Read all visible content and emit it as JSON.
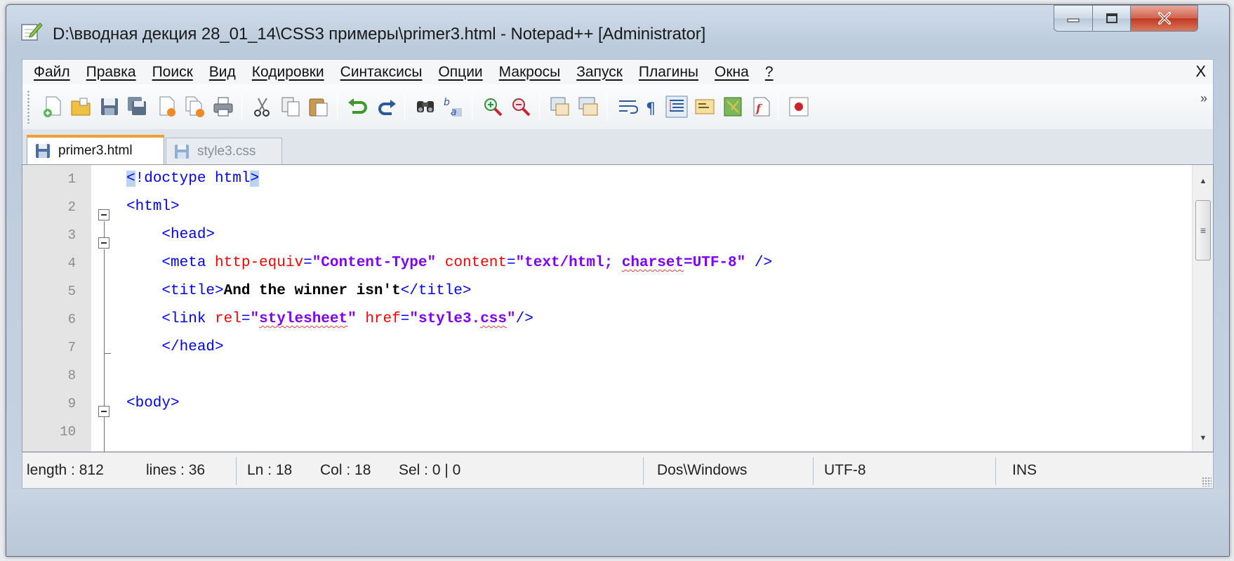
{
  "window": {
    "title": "D:\\вводная декция 28_01_14\\CSS3 примеры\\primer3.html - Notepad++ [Administrator]",
    "controls": {
      "minimize_icon": "minimize-icon",
      "maximize_icon": "maximize-icon",
      "close_icon": "close-icon"
    }
  },
  "menu": {
    "items": [
      "Файл",
      "Правка",
      "Поиск",
      "Вид",
      "Кодировки",
      "Синтаксисы",
      "Опции",
      "Макросы",
      "Запуск",
      "Плагины",
      "Окна",
      "?"
    ],
    "close": "X"
  },
  "toolbar": {
    "icons": [
      "new-file-icon",
      "open-file-icon",
      "save-icon",
      "save-all-icon",
      "close-icon",
      "close-all-icon",
      "print-icon",
      "cut-icon",
      "copy-icon",
      "paste-icon",
      "undo-icon",
      "redo-icon",
      "find-icon",
      "replace-icon",
      "zoom-in-icon",
      "zoom-out-icon",
      "sync-vertical-icon",
      "sync-horizontal-icon",
      "word-wrap-icon",
      "show-all-chars-icon",
      "indent-guide-icon",
      "user-language-icon",
      "doc-map-icon",
      "function-list-icon",
      "record-macro-icon"
    ],
    "more": "»"
  },
  "tabs": [
    {
      "label": "primer3.html",
      "active": true
    },
    {
      "label": "style3.css",
      "active": false
    }
  ],
  "editor": {
    "line_numbers": [
      "1",
      "2",
      "3",
      "4",
      "5",
      "6",
      "7",
      "8",
      "9",
      "10"
    ],
    "lines": {
      "l1": {
        "lt": "<",
        "sel": "!",
        "rest": "doctype html",
        "close": ">"
      },
      "l2": {
        "tag": "<html>"
      },
      "l3": {
        "indent": "    ",
        "tag": "<head>"
      },
      "l4": {
        "indent": "    ",
        "open": "<meta ",
        "a1": "http-equiv",
        "eq1": "=",
        "s1": "\"Content-Type\"",
        "sp": " ",
        "a2": "content",
        "eq2": "=",
        "s2a": "\"text/html; ",
        "s2b": "charset",
        "s2c": "=UTF-8\"",
        "end": " />"
      },
      "l5": {
        "indent": "    ",
        "open": "<title>",
        "text": "And the winner isn't",
        "close": "</title>"
      },
      "l6": {
        "indent": "    ",
        "open": "<link ",
        "a1": "rel",
        "eq1": "=",
        "s1a": "\"",
        "s1b": "stylesheet",
        "s1c": "\"",
        "sp": " ",
        "a2": "href",
        "eq2": "=",
        "s2a": "\"style3.",
        "s2b": "css",
        "s2c": "\"",
        "end": "/>"
      },
      "l7": {
        "indent": "    ",
        "tag": "</head>"
      },
      "l9": {
        "tag": "<body>"
      }
    }
  },
  "status": {
    "length": "length : 812",
    "lines": "lines : 36",
    "ln": "Ln : 18",
    "col": "Col : 18",
    "sel": "Sel : 0 | 0",
    "eol": "Dos\\Windows",
    "encoding": "UTF-8",
    "mode": "INS"
  }
}
